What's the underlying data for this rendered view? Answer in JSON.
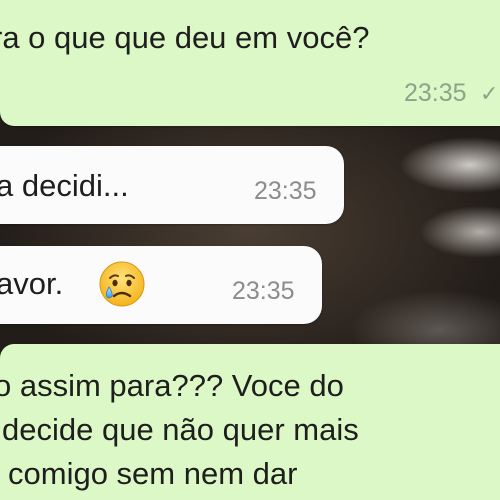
{
  "messages": [
    {
      "direction": "outgoing",
      "text": "ra o que que deu em você?",
      "time": "23:35",
      "status_icon": "single-check-icon"
    },
    {
      "direction": "incoming",
      "text": "a decidi...",
      "time": "23:35"
    },
    {
      "direction": "incoming",
      "text": "avor.",
      "time": "23:35",
      "emoji": "crying-face-emoji"
    },
    {
      "direction": "outgoing",
      "lines": [
        "o assim para??? Voce do",
        " decide que não quer mais",
        "comigo sem nem dar"
      ]
    }
  ],
  "colors": {
    "outgoing_bubble": "#dcf8c6",
    "incoming_bubble": "#fbfbfb",
    "timestamp": "#8c8c8c"
  }
}
